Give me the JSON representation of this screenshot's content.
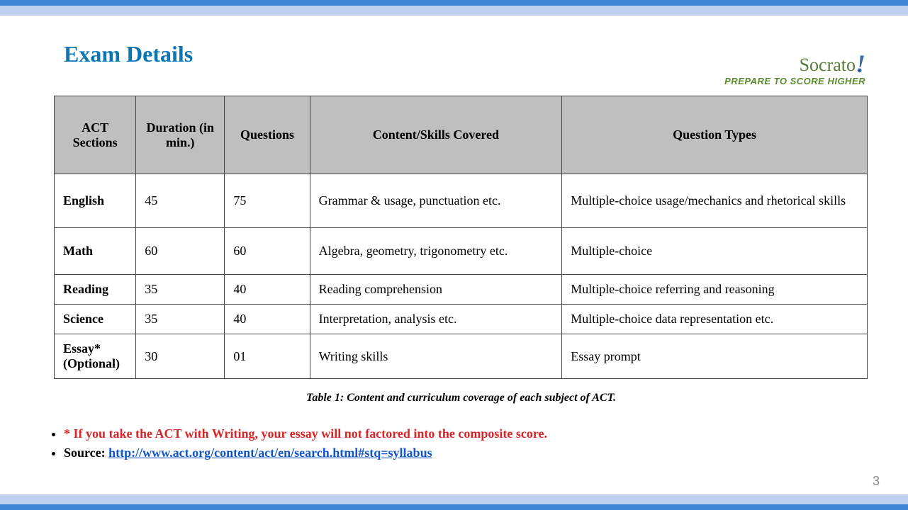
{
  "title": "Exam Details",
  "logo": {
    "name": "Socrato",
    "tagline": "PREPARE TO SCORE HIGHER"
  },
  "table": {
    "headers": {
      "sections": "ACT Sections",
      "duration": "Duration (in min.)",
      "questions": "Questions",
      "content": "Content/Skills  Covered",
      "types": "Question  Types"
    },
    "rows": [
      {
        "section": "English",
        "duration": "45",
        "questions": "75",
        "content": "Grammar & usage, punctuation etc.",
        "types": "Multiple-choice  usage/mechanics  and rhetorical  skills"
      },
      {
        "section": "Math",
        "duration": "60",
        "questions": "60",
        "content": "Algebra, geometry, trigonometry etc.",
        "types": "Multiple-choice"
      },
      {
        "section": "Reading",
        "duration": "35",
        "questions": "40",
        "content": "Reading comprehension",
        "types": "Multiple-choice  referring  and reasoning"
      },
      {
        "section": "Science",
        "duration": "35",
        "questions": "40",
        "content": "Interpretation,  analysis  etc.",
        "types": "Multiple-choice  data representation  etc."
      },
      {
        "section": "Essay* (Optional)",
        "duration": "30",
        "questions": "01",
        "content": "Writing skills",
        "types": "Essay prompt"
      }
    ]
  },
  "caption": "Table 1: Content and curriculum coverage of each subject of ACT.",
  "bullets": {
    "note": "* If you take the ACT with Writing,  your essay will not factored into the composite score.",
    "source_label": " Source: ",
    "source_url": "http://www.act.org/content/act/en/search.html#stq=syllabus"
  },
  "page_number": "3"
}
